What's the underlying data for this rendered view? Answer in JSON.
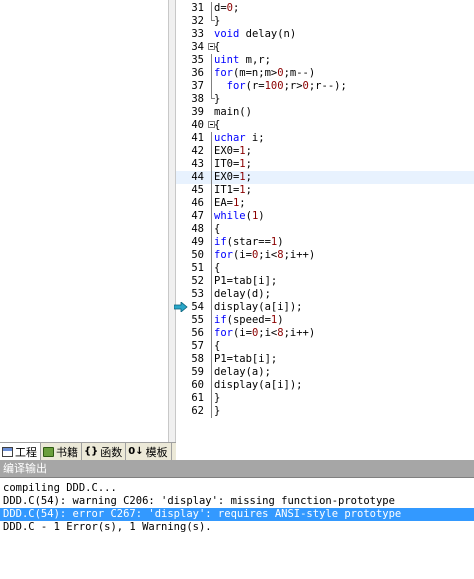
{
  "left_tabs": [
    {
      "label": "工程",
      "icon": "project-icon",
      "active": true
    },
    {
      "label": "书籍",
      "icon": "books-icon",
      "active": false
    },
    {
      "label": "函数",
      "icon": "functions-icon",
      "active": false
    },
    {
      "label": "模板",
      "icon": "templates-icon",
      "active": false
    }
  ],
  "editor": {
    "lines": [
      {
        "n": "31",
        "t": "d=0;",
        "fold": "line"
      },
      {
        "n": "32",
        "t": "}",
        "fold": "end"
      },
      {
        "n": "33",
        "t": "void delay(n)",
        "fold": ""
      },
      {
        "n": "34",
        "t": "{",
        "fold": "box"
      },
      {
        "n": "35",
        "t": "uint m,r;",
        "fold": "line"
      },
      {
        "n": "36",
        "t": "for(m=n;m>0;m--)",
        "fold": "line"
      },
      {
        "n": "37",
        "t": "  for(r=100;r>0;r--);",
        "fold": "line"
      },
      {
        "n": "38",
        "t": "}",
        "fold": "end"
      },
      {
        "n": "39",
        "t": "main()",
        "fold": ""
      },
      {
        "n": "40",
        "t": "{",
        "fold": "box"
      },
      {
        "n": "41",
        "t": "uchar i;",
        "fold": "line"
      },
      {
        "n": "42",
        "t": "EX0=1;",
        "fold": "line"
      },
      {
        "n": "43",
        "t": "IT0=1;",
        "fold": "line"
      },
      {
        "n": "44",
        "t": "EX0=1;",
        "fold": "line",
        "highlight": true
      },
      {
        "n": "45",
        "t": "IT1=1;",
        "fold": "line"
      },
      {
        "n": "46",
        "t": "EA=1;",
        "fold": "line"
      },
      {
        "n": "47",
        "t": "while(1)",
        "fold": "line"
      },
      {
        "n": "48",
        "t": "{",
        "fold": "line"
      },
      {
        "n": "49",
        "t": "if(star==1)",
        "fold": "line"
      },
      {
        "n": "50",
        "t": "for(i=0;i<8;i++)",
        "fold": "line"
      },
      {
        "n": "51",
        "t": "{",
        "fold": "line"
      },
      {
        "n": "52",
        "t": "P1=tab[i];",
        "fold": "line"
      },
      {
        "n": "53",
        "t": "delay(d);",
        "fold": "line"
      },
      {
        "n": "54",
        "t": "display(a[i]);",
        "fold": "line",
        "marker": true
      },
      {
        "n": "55",
        "t": "if(speed=1)",
        "fold": "line"
      },
      {
        "n": "56",
        "t": "for(i=0;i<8;i++)",
        "fold": "line"
      },
      {
        "n": "57",
        "t": "{",
        "fold": "line"
      },
      {
        "n": "58",
        "t": "P1=tab[i];",
        "fold": "line"
      },
      {
        "n": "59",
        "t": "delay(a);",
        "fold": "line"
      },
      {
        "n": "60",
        "t": "display(a[i]);",
        "fold": "line"
      },
      {
        "n": "61",
        "t": "}",
        "fold": "line"
      },
      {
        "n": "62",
        "t": "}",
        "fold": "line"
      }
    ]
  },
  "output": {
    "title": "编译输出",
    "lines": [
      {
        "text": "compiling DDD.C...",
        "selected": false
      },
      {
        "text": "DDD.C(54): warning C206: 'display': missing function-prototype",
        "selected": false
      },
      {
        "text": "DDD.C(54): error C267: 'display': requires ANSI-style prototype",
        "selected": true
      },
      {
        "text": "DDD.C - 1 Error(s), 1 Warning(s).",
        "selected": false
      }
    ]
  },
  "colors": {
    "keyword": "#0000ff",
    "number": "#8b0000",
    "selection": "#3399ff",
    "line_highlight": "#e8f2fe",
    "marker": "#2aa7c9"
  }
}
